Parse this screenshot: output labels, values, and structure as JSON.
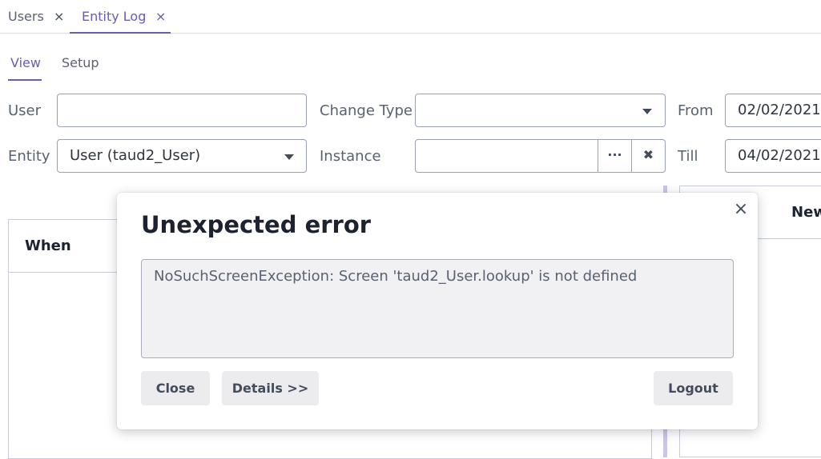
{
  "top_tabs": [
    {
      "label": "Users",
      "close": "×"
    },
    {
      "label": "Entity Log",
      "close": "×"
    }
  ],
  "sub_tabs": [
    "View",
    "Setup"
  ],
  "filters": {
    "user_label": "User",
    "user_value": "",
    "change_type_label": "Change Type",
    "change_type_value": "",
    "from_label": "From",
    "from_value": "02/02/2021",
    "entity_label": "Entity",
    "entity_value": "User (taud2_User)",
    "instance_label": "Instance",
    "instance_value": "",
    "instance_picker": "···",
    "instance_clear": "✖",
    "till_label": "Till",
    "till_value": "04/02/2021"
  },
  "table_left": {
    "header": "When"
  },
  "table_right": {
    "header": "New"
  },
  "dialog": {
    "title": "Unexpected error",
    "close": "×",
    "message": "NoSuchScreenException: Screen 'taud2_User.lookup' is not defined",
    "buttons": {
      "close": "Close",
      "details": "Details >>",
      "logout": "Logout"
    }
  },
  "colors": {
    "accent": "#6b5bb6",
    "splitter": "#c9c6e6"
  }
}
